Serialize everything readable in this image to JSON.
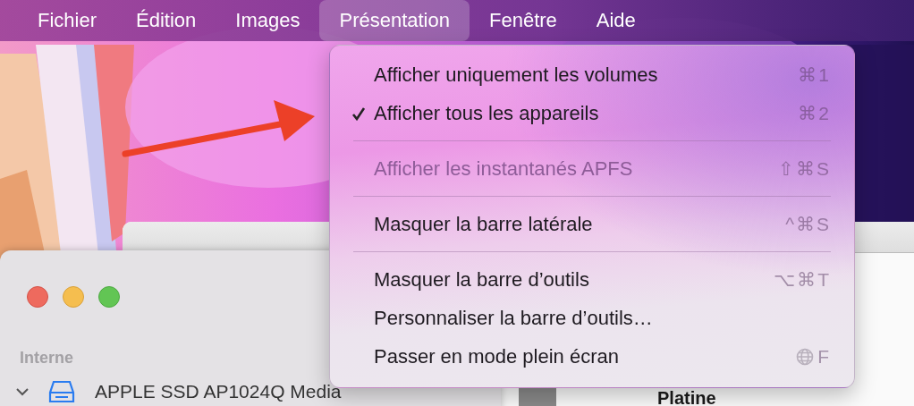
{
  "menu_bar": [
    {
      "label": "Fichier",
      "selected": false
    },
    {
      "label": "Édition",
      "selected": false
    },
    {
      "label": "Images",
      "selected": false
    },
    {
      "label": "Présentation",
      "selected": true
    },
    {
      "label": "Fenêtre",
      "selected": false
    },
    {
      "label": "Aide",
      "selected": false
    }
  ],
  "menu": [
    {
      "kind": "item",
      "label": "Afficher uniquement les volumes",
      "shortcut": "⌘1",
      "checked": false,
      "disabled": false
    },
    {
      "kind": "item",
      "label": "Afficher tous les appareils",
      "shortcut": "⌘2",
      "checked": true,
      "disabled": false
    },
    {
      "kind": "separator"
    },
    {
      "kind": "item",
      "label": "Afficher les instantanés APFS",
      "shortcut": "⇧⌘S",
      "checked": false,
      "disabled": true
    },
    {
      "kind": "separator"
    },
    {
      "kind": "item",
      "label": "Masquer la barre latérale",
      "shortcut": "^⌘S",
      "checked": false,
      "disabled": false
    },
    {
      "kind": "separator"
    },
    {
      "kind": "item",
      "label": "Masquer la barre d’outils",
      "shortcut": "⌥⌘T",
      "checked": false,
      "disabled": false
    },
    {
      "kind": "item",
      "label": "Personnaliser la barre d’outils…",
      "checked": false,
      "disabled": false
    },
    {
      "kind": "globe",
      "label": "Passer en mode plein écran",
      "shortcut": "F",
      "checked": false,
      "disabled": false
    }
  ],
  "sidebar": {
    "section": "Interne",
    "items": [
      {
        "label": "APPLE SSD AP1024Q Media",
        "expanded": true
      }
    ]
  },
  "detail": {
    "title": "Platine"
  }
}
